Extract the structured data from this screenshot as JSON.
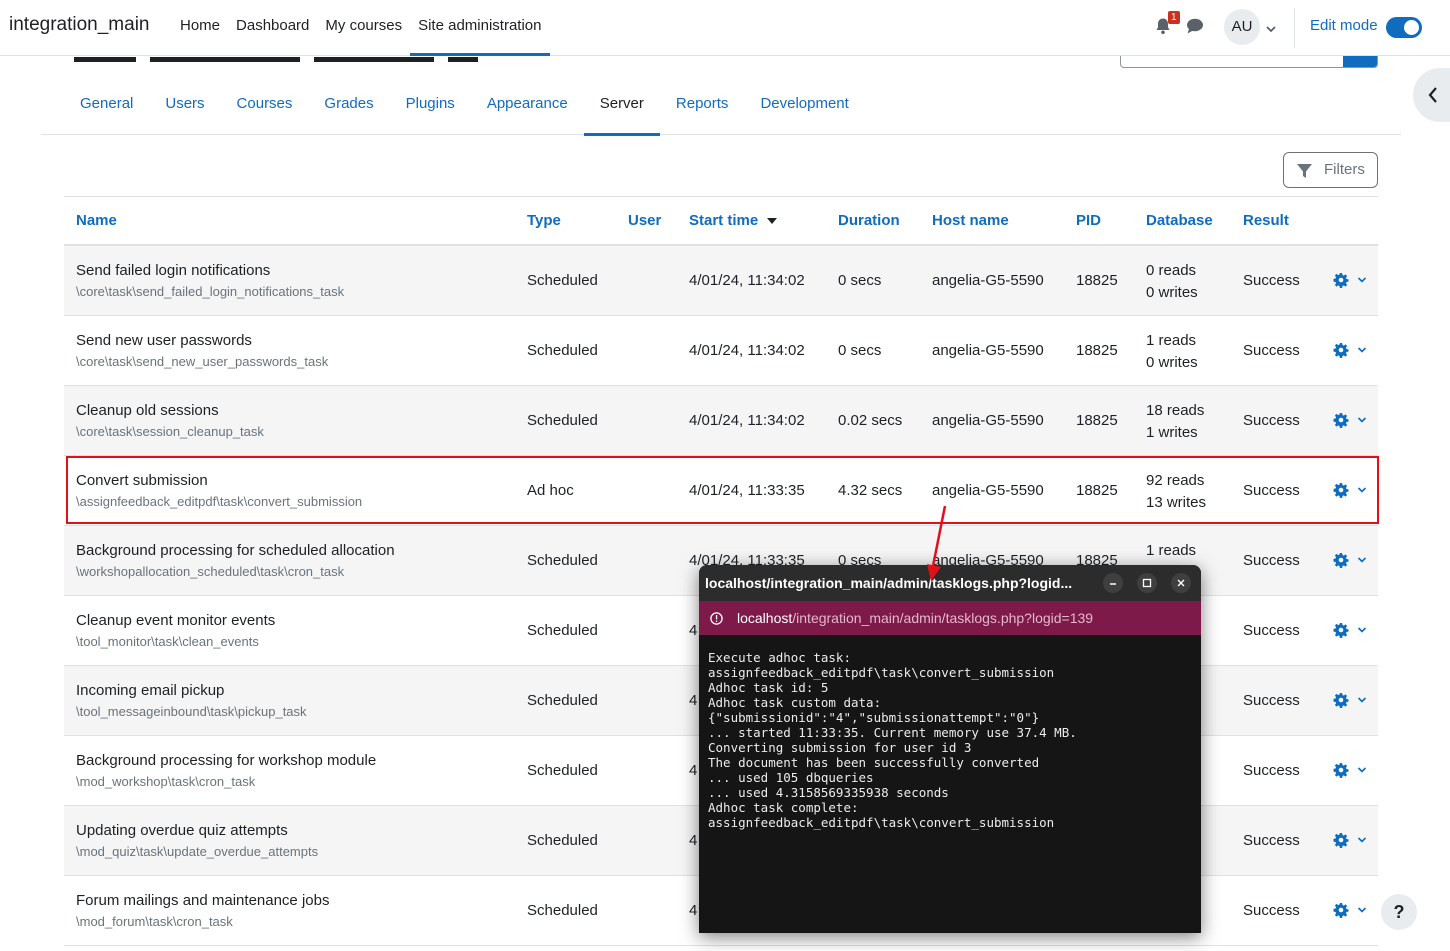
{
  "navbar": {
    "brand": "integration_main",
    "links": [
      {
        "label": "Home",
        "active": false
      },
      {
        "label": "Dashboard",
        "active": false
      },
      {
        "label": "My courses",
        "active": false
      },
      {
        "label": "Site administration",
        "active": true
      }
    ],
    "notifications_count": "1",
    "avatar_initials": "AU",
    "edit_mode_label": "Edit mode",
    "edit_mode_on": true,
    "accent_color": "#0f6cbf"
  },
  "subnav": {
    "tabs": [
      {
        "label": "General",
        "active": false
      },
      {
        "label": "Users",
        "active": false
      },
      {
        "label": "Courses",
        "active": false
      },
      {
        "label": "Grades",
        "active": false
      },
      {
        "label": "Plugins",
        "active": false
      },
      {
        "label": "Appearance",
        "active": false
      },
      {
        "label": "Server",
        "active": true
      },
      {
        "label": "Reports",
        "active": false
      },
      {
        "label": "Development",
        "active": false
      }
    ]
  },
  "filters": {
    "label": "Filters"
  },
  "table": {
    "columns": {
      "name": "Name",
      "type": "Type",
      "user": "User",
      "start_time": "Start time",
      "duration": "Duration",
      "host": "Host name",
      "pid": "PID",
      "database": "Database",
      "result": "Result"
    },
    "sorted_by": "Start time",
    "rows": [
      {
        "name": "Send failed login notifications",
        "classname": "\\core\\task\\send_failed_login_notifications_task",
        "type": "Scheduled",
        "user": "",
        "start": "4/01/24, 11:34:02",
        "duration": "0 secs",
        "host": "angelia-G5-5590",
        "pid": "18825",
        "reads": "0 reads",
        "writes": "0 writes",
        "result": "Success"
      },
      {
        "name": "Send new user passwords",
        "classname": "\\core\\task\\send_new_user_passwords_task",
        "type": "Scheduled",
        "user": "",
        "start": "4/01/24, 11:34:02",
        "duration": "0 secs",
        "host": "angelia-G5-5590",
        "pid": "18825",
        "reads": "1 reads",
        "writes": "0 writes",
        "result": "Success"
      },
      {
        "name": "Cleanup old sessions",
        "classname": "\\core\\task\\session_cleanup_task",
        "type": "Scheduled",
        "user": "",
        "start": "4/01/24, 11:34:02",
        "duration": "0.02 secs",
        "host": "angelia-G5-5590",
        "pid": "18825",
        "reads": "18 reads",
        "writes": "1 writes",
        "result": "Success"
      },
      {
        "name": "Convert submission",
        "classname": "\\assignfeedback_editpdf\\task\\convert_submission",
        "type": "Ad hoc",
        "user": "",
        "start": "4/01/24, 11:33:35",
        "duration": "4.32 secs",
        "host": "angelia-G5-5590",
        "pid": "18825",
        "reads": "92 reads",
        "writes": "13 writes",
        "result": "Success"
      },
      {
        "name": "Background processing for scheduled allocation",
        "classname": "\\workshopallocation_scheduled\\task\\cron_task",
        "type": "Scheduled",
        "user": "",
        "start": "4/01/24, 11:33:35",
        "duration": "0 secs",
        "host": "angelia-G5-5590",
        "pid": "18825",
        "reads": "1 reads",
        "writes": "",
        "result": "Success"
      },
      {
        "name": "Cleanup event monitor events",
        "classname": "\\tool_monitor\\task\\clean_events",
        "type": "Scheduled",
        "user": "",
        "start": "4",
        "duration": "",
        "host": "",
        "pid": "",
        "reads": "",
        "writes": "",
        "result": "Success"
      },
      {
        "name": "Incoming email pickup",
        "classname": "\\tool_messageinbound\\task\\pickup_task",
        "type": "Scheduled",
        "user": "",
        "start": "4",
        "duration": "",
        "host": "",
        "pid": "",
        "reads": "",
        "writes": "",
        "result": "Success"
      },
      {
        "name": "Background processing for workshop module",
        "classname": "\\mod_workshop\\task\\cron_task",
        "type": "Scheduled",
        "user": "",
        "start": "4",
        "duration": "",
        "host": "",
        "pid": "",
        "reads": "",
        "writes": "",
        "result": "Success"
      },
      {
        "name": "Updating overdue quiz attempts",
        "classname": "\\mod_quiz\\task\\update_overdue_attempts",
        "type": "Scheduled",
        "user": "",
        "start": "4",
        "duration": "",
        "host": "",
        "pid": "",
        "reads": "",
        "writes": "",
        "result": "Success"
      },
      {
        "name": "Forum mailings and maintenance jobs",
        "classname": "\\mod_forum\\task\\cron_task",
        "type": "Scheduled",
        "user": "",
        "start": "4",
        "duration": "",
        "host": "",
        "pid": "",
        "reads": "",
        "writes": "",
        "result": "Success"
      }
    ]
  },
  "popup": {
    "title": "localhost/integration_main/admin/tasklogs.php?logid...",
    "url_host": "localhost",
    "url_path": "/integration_main/admin/tasklogs.php?logid=139",
    "output_lines": [
      "Execute adhoc task:",
      "assignfeedback_editpdf\\task\\convert_submission",
      "Adhoc task id: 5",
      "Adhoc task custom data:",
      "{\"submissionid\":\"4\",\"submissionattempt\":\"0\"}",
      "... started 11:33:35. Current memory use 37.4 MB.",
      "Converting submission for user id 3",
      "The document has been successfully converted",
      "... used 105 dbqueries",
      "... used 4.3158569335938 seconds",
      "Adhoc task complete:",
      "assignfeedback_editpdf\\task\\convert_submission"
    ]
  },
  "help": {
    "label": "?"
  }
}
